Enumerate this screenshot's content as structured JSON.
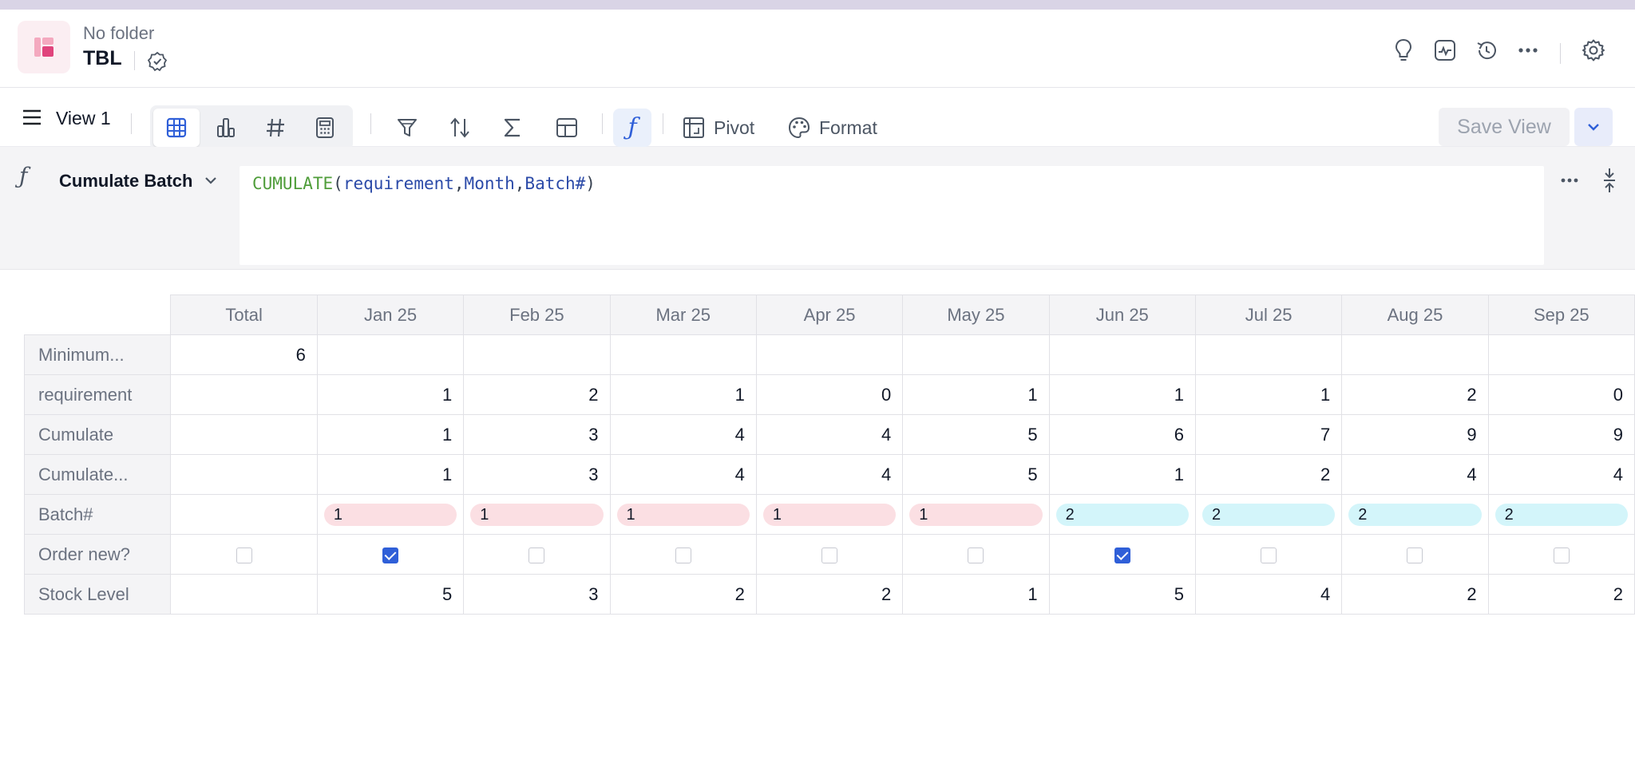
{
  "header": {
    "folder": "No folder",
    "title": "TBL",
    "icons": [
      "lightbulb-icon",
      "activity-icon",
      "history-icon",
      "more-icon",
      "settings-icon"
    ]
  },
  "toolbar": {
    "view_name": "View 1",
    "view_types": [
      "table-view-icon",
      "chart-view-icon",
      "number-view-icon",
      "calculator-view-icon"
    ],
    "tools": [
      "filter-icon",
      "sort-icon",
      "sum-icon",
      "layout-icon",
      "formula-icon"
    ],
    "pivot_label": "Pivot",
    "format_label": "Format",
    "save_view_label": "Save View"
  },
  "formula": {
    "fx": "ƒ",
    "field_name": "Cumulate Batch",
    "fn": "CUMULATE",
    "open": "(",
    "arg1": "requirement",
    "comma1": ",",
    "arg2": "Month",
    "comma2": ",",
    "arg3": "Batch#",
    "close": ")"
  },
  "table": {
    "columns": [
      "Total",
      "Jan 25",
      "Feb 25",
      "Mar 25",
      "Apr 25",
      "May 25",
      "Jun 25",
      "Jul 25",
      "Aug 25",
      "Sep 25"
    ],
    "rows": [
      {
        "label": "Minimum...",
        "type": "num",
        "cells": [
          "6",
          "",
          "",
          "",
          "",
          "",
          "",
          "",
          "",
          ""
        ]
      },
      {
        "label": "requirement",
        "type": "num",
        "cells": [
          "",
          "1",
          "2",
          "1",
          "0",
          "1",
          "1",
          "1",
          "2",
          "0"
        ]
      },
      {
        "label": "Cumulate",
        "type": "num",
        "cells": [
          "",
          "1",
          "3",
          "4",
          "4",
          "5",
          "6",
          "7",
          "9",
          "9"
        ]
      },
      {
        "label": "Cumulate...",
        "type": "num",
        "cells": [
          "",
          "1",
          "3",
          "4",
          "4",
          "5",
          "1",
          "2",
          "4",
          "4"
        ]
      },
      {
        "label": "Batch#",
        "type": "pill",
        "cells": [
          "",
          "1",
          "1",
          "1",
          "1",
          "1",
          "2",
          "2",
          "2",
          "2"
        ]
      },
      {
        "label": "Order new?",
        "type": "check",
        "cells": [
          false,
          true,
          false,
          false,
          false,
          false,
          true,
          false,
          false,
          false
        ]
      },
      {
        "label": "Stock Level",
        "type": "num",
        "cells": [
          "",
          "5",
          "3",
          "2",
          "2",
          "1",
          "5",
          "4",
          "2",
          "2"
        ]
      }
    ],
    "pill_colors": {
      "1": "#fbdfe3",
      "2": "#d3f5fa"
    }
  },
  "colors": {
    "accent": "#2f5fd8",
    "brand_pink": "#e0447c",
    "formula_fn": "#4f9d3a",
    "formula_arg": "#2b4aa8"
  }
}
